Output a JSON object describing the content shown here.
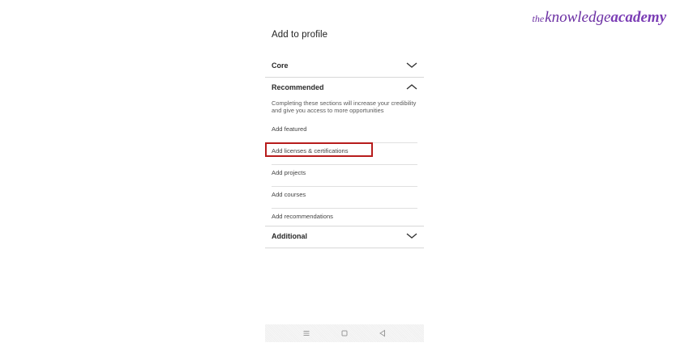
{
  "logo": {
    "the": "the",
    "knowledge": "knowledge",
    "academy": "academy",
    "color": "#6b2fa3"
  },
  "panel": {
    "title": "Add to profile",
    "sections": {
      "core": {
        "label": "Core",
        "icon": "chevron-down-icon",
        "expanded": false
      },
      "recommended": {
        "label": "Recommended",
        "icon": "chevron-up-icon",
        "expanded": true,
        "description": "Completing these sections will increase your credibility and give you access to more opportunities",
        "items": [
          {
            "label": "Add featured"
          },
          {
            "label": "Add licenses & certifications",
            "highlighted": true
          },
          {
            "label": "Add projects"
          },
          {
            "label": "Add courses"
          },
          {
            "label": "Add recommendations"
          }
        ]
      },
      "additional": {
        "label": "Additional",
        "icon": "chevron-down-icon",
        "expanded": false
      }
    }
  },
  "navbar": {
    "buttons": [
      "menu-icon",
      "home-icon",
      "back-icon"
    ]
  },
  "colors": {
    "highlight": "#b71c1c",
    "divider": "#d7d7d7",
    "text": "#222222"
  }
}
